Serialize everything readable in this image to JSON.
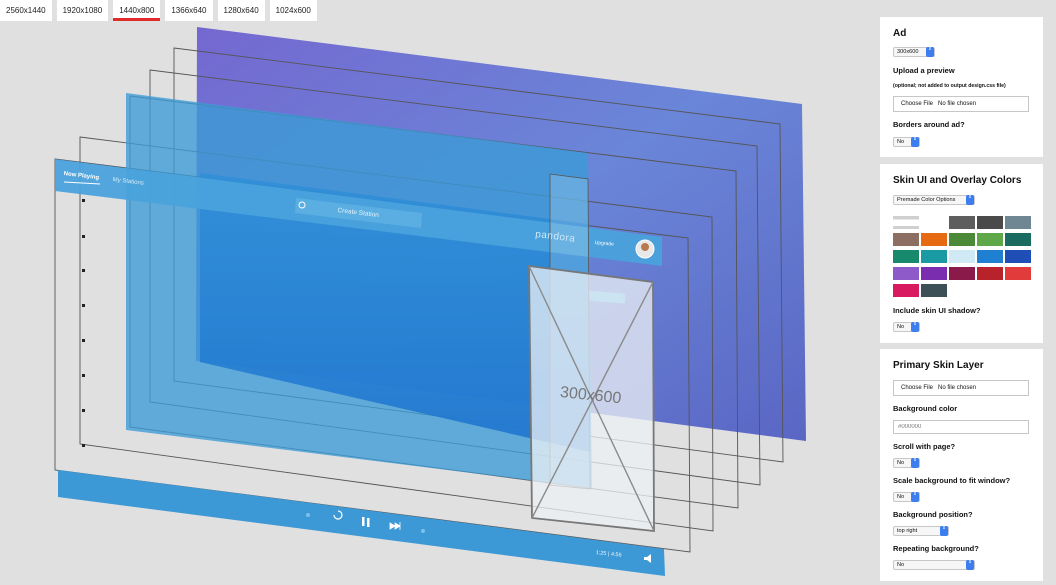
{
  "resolution_tabs": [
    {
      "label": "2560x1440",
      "active": false
    },
    {
      "label": "1920x1080",
      "active": false
    },
    {
      "label": "1440x800",
      "active": true
    },
    {
      "label": "1366x640",
      "active": false
    },
    {
      "label": "1280x640",
      "active": false
    },
    {
      "label": "1024x600",
      "active": false
    }
  ],
  "preview": {
    "nav_now_playing": "Now Playing",
    "nav_my_stations": "My Stations",
    "search_placeholder": "Create Station",
    "brand": "pandora",
    "upgrade_label": "Upgrade",
    "ad_label": "300x600",
    "time_elapsed": "1:25",
    "time_total": "4:56",
    "colors": {
      "skin_blue": "#3a97d4",
      "bg_purple": "#6a6fcf",
      "player_bar": "#3d98d6"
    }
  },
  "ad_section": {
    "title": "Ad",
    "size_select": "300x600",
    "upload_label": "Upload a preview",
    "upload_note": "(optional; not added to output design.css file)",
    "file_button": "Choose File",
    "file_status": "No file chosen",
    "borders_label": "Borders around ad?",
    "borders_value": "No"
  },
  "skin_section": {
    "title": "Skin UI and Overlay Colors",
    "premade_select": "Premade Color Options",
    "swatches": [
      "#d0d0d0",
      "#ffffff",
      "#5e5e5e",
      "#4a4a4a",
      "#6f8793",
      "#8d6e63",
      "#e56a12",
      "#4c8a3a",
      "#5ea84a",
      "#1c6b60",
      "#178a6e",
      "#1a9aa3",
      "#cfe9f5",
      "#1f7fd0",
      "#1f4fb6",
      "#8e5ac9",
      "#7b2db0",
      "#8a1a4a",
      "#b8232b",
      "#e23b3b",
      "#d81b60",
      "#3d5058"
    ],
    "shadow_label": "Include skin UI shadow?",
    "shadow_value": "No"
  },
  "primary_section": {
    "title": "Primary Skin Layer",
    "file_button": "Choose File",
    "file_status": "No file chosen",
    "bg_color_label": "Background color",
    "bg_color_placeholder": "#000000",
    "scroll_label": "Scroll with page?",
    "scroll_value": "No",
    "scale_label": "Scale background to fit window?",
    "scale_value": "No",
    "position_label": "Background position?",
    "position_value": "top right",
    "repeat_label": "Repeating background?",
    "repeat_value": "No"
  }
}
